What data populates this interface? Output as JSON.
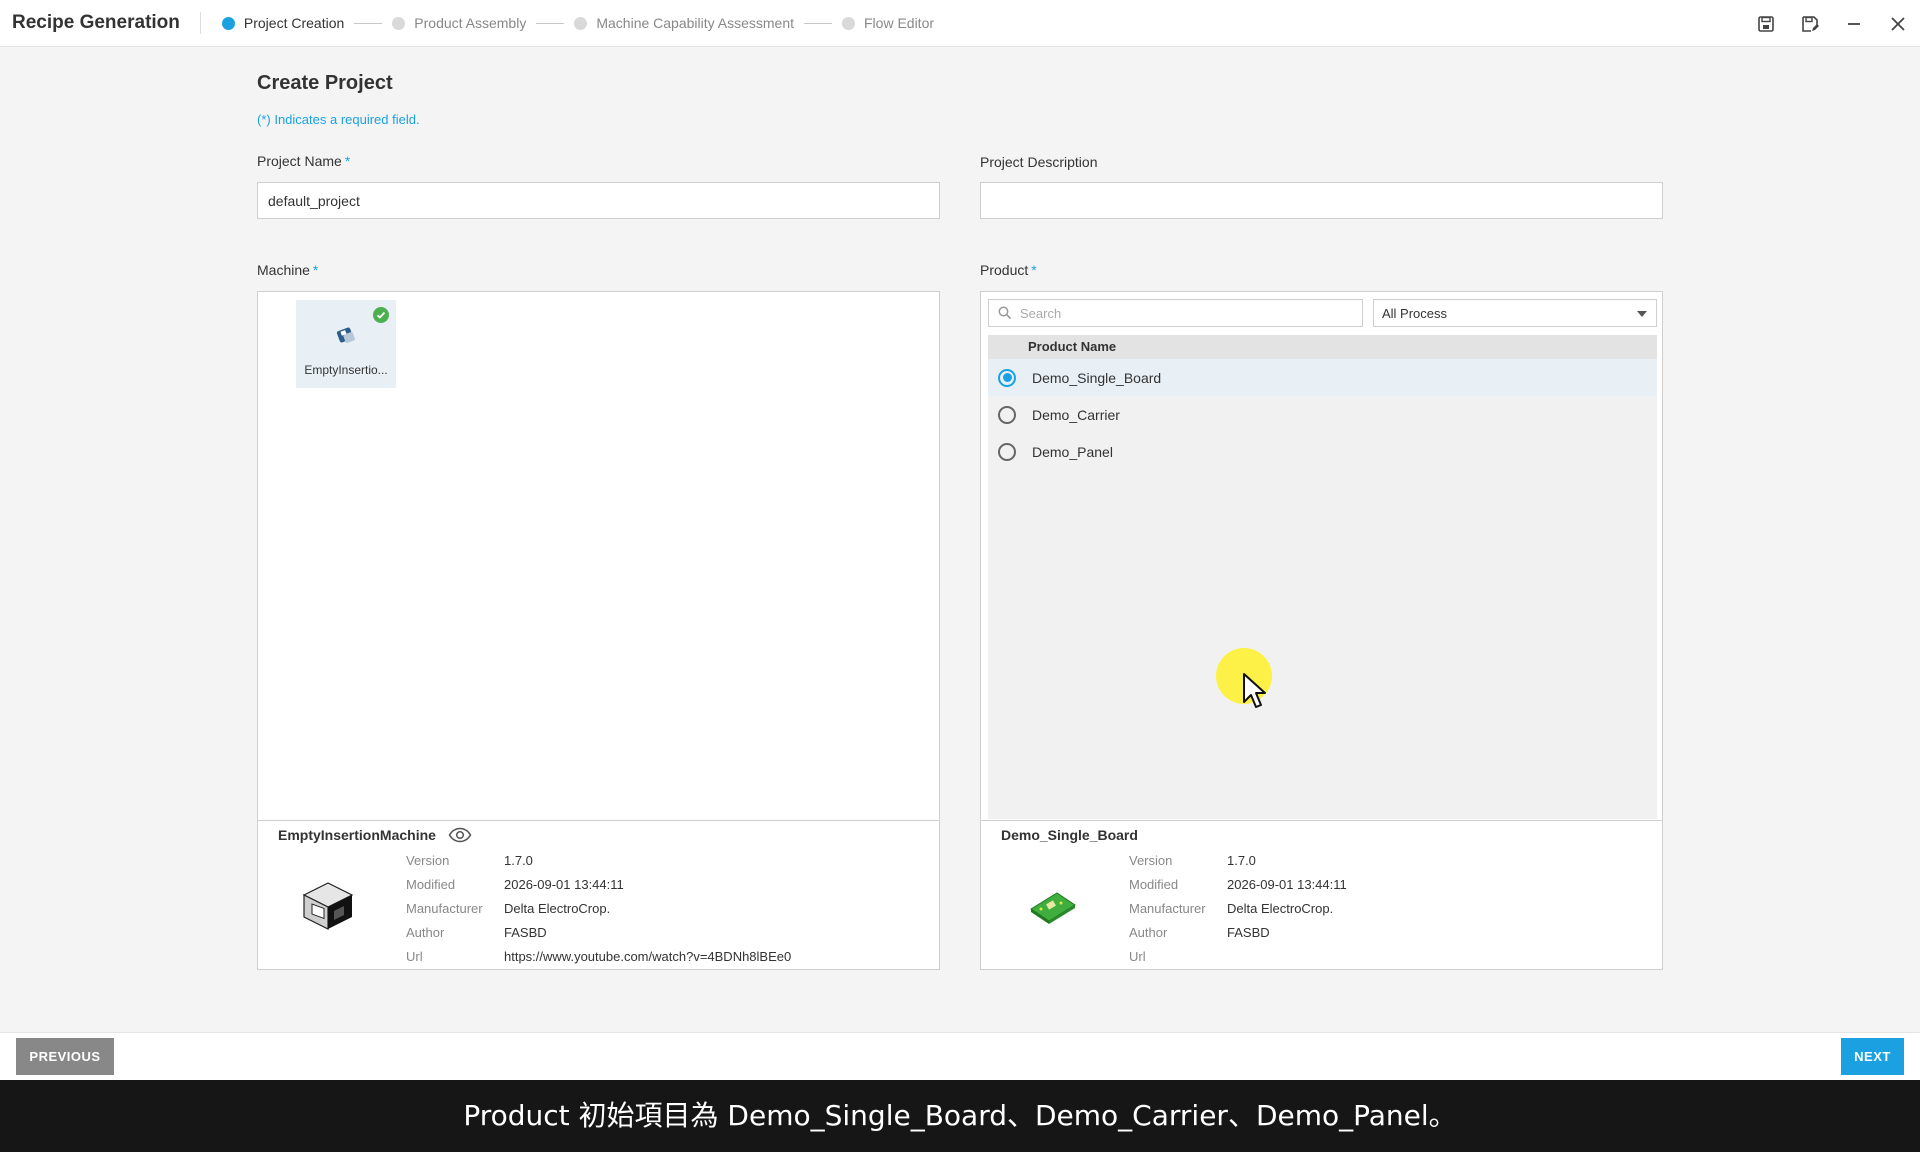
{
  "header": {
    "app_title": "Recipe Generation",
    "steps": [
      {
        "label": "Project Creation",
        "active": true
      },
      {
        "label": "Product Assembly",
        "active": false
      },
      {
        "label": "Machine Capability Assessment",
        "active": false
      },
      {
        "label": "Flow Editor",
        "active": false
      }
    ],
    "controls": [
      "save-icon",
      "save-as-icon",
      "minimize-icon",
      "close-icon"
    ]
  },
  "form": {
    "title": "Create Project",
    "required_note": "(*) Indicates a required field.",
    "project_name_label": "Project Name",
    "project_name_value": "default_project",
    "project_description_label": "Project Description",
    "project_description_value": "",
    "required_marker": "*"
  },
  "machine": {
    "label": "Machine",
    "cards": [
      {
        "name": "EmptyInsertio...",
        "selected": true
      }
    ],
    "detail": {
      "name": "EmptyInsertionMachine",
      "rows": [
        {
          "key": "Version",
          "value": "1.7.0"
        },
        {
          "key": "Modified",
          "value": "2026-09-01 13:44:11"
        },
        {
          "key": "Manufacturer",
          "value": "Delta ElectroCrop."
        },
        {
          "key": "Author",
          "value": "FASBD"
        },
        {
          "key": "Url",
          "value": "https://www.youtube.com/watch?v=4BDNh8lBEe0"
        }
      ]
    }
  },
  "product": {
    "label": "Product",
    "search_placeholder": "Search",
    "process_filter": "All Process",
    "column_header": "Product Name",
    "items": [
      {
        "name": "Demo_Single_Board",
        "selected": true
      },
      {
        "name": "Demo_Carrier",
        "selected": false
      },
      {
        "name": "Demo_Panel",
        "selected": false
      }
    ],
    "detail": {
      "name": "Demo_Single_Board",
      "rows": [
        {
          "key": "Version",
          "value": "1.7.0"
        },
        {
          "key": "Modified",
          "value": "2026-09-01 13:44:11"
        },
        {
          "key": "Manufacturer",
          "value": "Delta ElectroCrop."
        },
        {
          "key": "Author",
          "value": "FASBD"
        },
        {
          "key": "Url",
          "value": ""
        }
      ]
    }
  },
  "footer": {
    "previous_label": "PREVIOUS",
    "next_label": "NEXT"
  },
  "caption": "Product 初始項目為 Demo_Single_Board、Demo_Carrier、Demo_Panel。",
  "colors": {
    "accent": "#1ba1e2",
    "selected_row": "#e8f0f6",
    "check_green": "#4caf50",
    "prev_button": "#888888"
  }
}
